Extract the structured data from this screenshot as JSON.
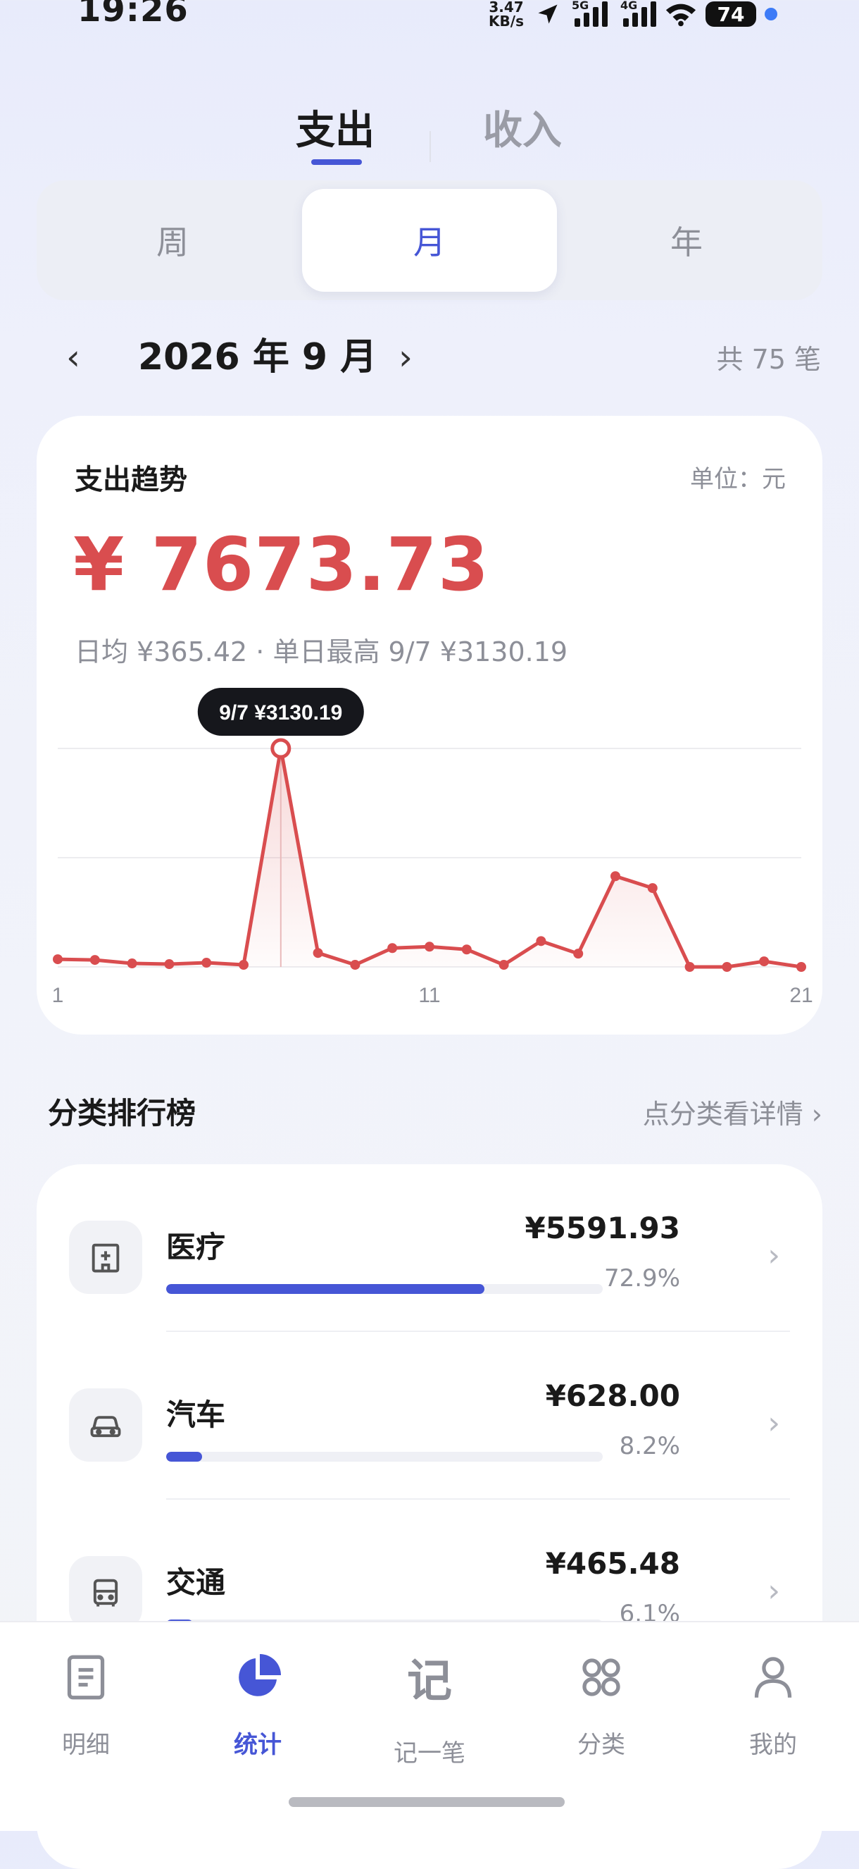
{
  "status_bar": {
    "time": "19:26",
    "speed_value": "3.47",
    "speed_unit": "KB/s",
    "net1": "5G",
    "net2": "4G",
    "battery": "74",
    "icons": [
      "location-arrow-icon",
      "signal-icon",
      "wifi-icon",
      "battery-icon"
    ]
  },
  "tabs": {
    "expense": "支出",
    "income": "收入",
    "active": "expense"
  },
  "period": {
    "week": "周",
    "month": "月",
    "year": "年",
    "active": "month"
  },
  "month_nav": {
    "prev": "‹",
    "label": "2026 年 9 月",
    "next": "›",
    "count": "共 75 笔"
  },
  "trend": {
    "title": "支出趋势",
    "unit": "单位：元",
    "total": "¥ 7673.73",
    "stats": "日均 ¥365.42 · 单日最高 9/7 ¥3130.19",
    "tooltip": "9/7 ¥3130.19",
    "color": "#d94d4f"
  },
  "chart_data": {
    "type": "area",
    "x": [
      1,
      2,
      3,
      4,
      5,
      6,
      7,
      8,
      9,
      10,
      11,
      12,
      13,
      14,
      15,
      16,
      17,
      18,
      19,
      20,
      21
    ],
    "values": [
      110,
      100,
      50,
      40,
      60,
      30,
      3130.19,
      200,
      30,
      270,
      290,
      250,
      30,
      370,
      190,
      1300,
      1130,
      0,
      0,
      80,
      0
    ],
    "x_ticks": [
      "1",
      "11",
      "21"
    ],
    "highlight": {
      "x": 7,
      "label": "9/7 ¥3130.19"
    },
    "ylim": [
      0,
      3130.19
    ],
    "grid": true
  },
  "ranking": {
    "title": "分类排行榜",
    "hint": "点分类看详情 ›",
    "items": [
      {
        "name": "医疗",
        "amount": "¥5591.93",
        "pct": "72.9%",
        "fraction": 0.729,
        "icon": "hospital-icon"
      },
      {
        "name": "汽车",
        "amount": "¥628.00",
        "pct": "8.2%",
        "fraction": 0.082,
        "icon": "car-icon"
      },
      {
        "name": "交通",
        "amount": "¥465.48",
        "pct": "6.1%",
        "fraction": 0.061,
        "icon": "bus-icon"
      }
    ]
  },
  "nav": {
    "items": [
      {
        "label": "明细",
        "icon": "list-icon"
      },
      {
        "label": "统计",
        "icon": "pie-chart-icon"
      },
      {
        "label": "记一笔",
        "icon_text": "记"
      },
      {
        "label": "分类",
        "icon": "grid-icon"
      },
      {
        "label": "我的",
        "icon": "user-icon"
      }
    ],
    "active": 1
  },
  "accent": "#4656d6"
}
